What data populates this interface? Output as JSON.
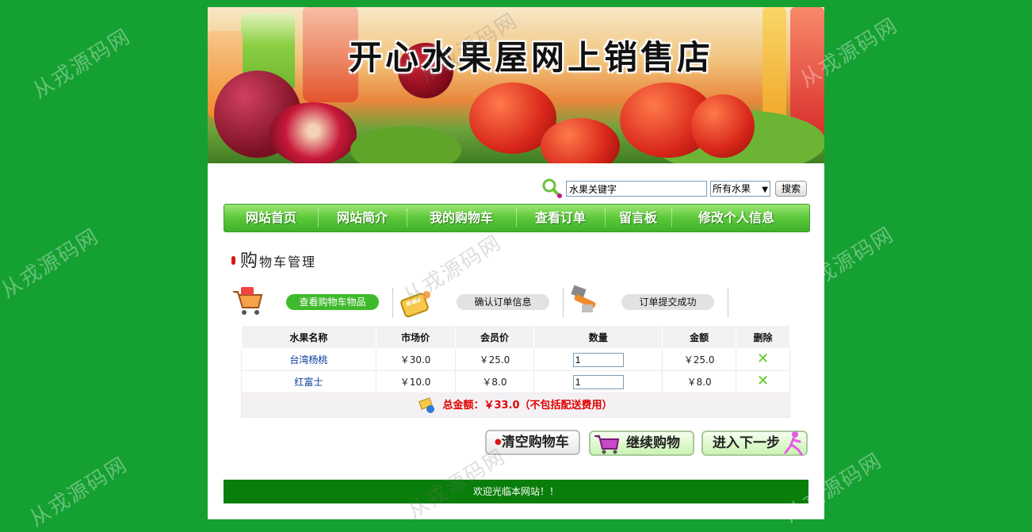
{
  "banner": {
    "title": "开心水果屋网上销售店"
  },
  "search": {
    "value": "水果关键字",
    "category": "所有水果",
    "button": "搜索"
  },
  "nav": {
    "items": [
      {
        "label": "网站首页"
      },
      {
        "label": "网站简介"
      },
      {
        "label": "我的购物车"
      },
      {
        "label": "查看订单"
      },
      {
        "label": "留言板"
      },
      {
        "label": "修改个人信息"
      }
    ]
  },
  "section": {
    "title_first": "购",
    "title_rest": "物车管理"
  },
  "steps": [
    {
      "label": "查看购物车物品",
      "active": true
    },
    {
      "label": "确认订单信息",
      "active": false
    },
    {
      "label": "订单提交成功",
      "active": false
    }
  ],
  "table": {
    "headers": [
      "水果名称",
      "市场价",
      "会员价",
      "数量",
      "金额",
      "删除"
    ],
    "rows": [
      {
        "name": "台湾杨桃",
        "market": "￥30.0",
        "member": "￥25.0",
        "qty": "1",
        "amount": "￥25.0"
      },
      {
        "name": "红富士",
        "market": "￥10.0",
        "member": "￥8.0",
        "qty": "1",
        "amount": "￥8.0"
      }
    ],
    "total": "总金额：￥33.0（不包括配送费用）"
  },
  "buttons": {
    "clear": "清空购物车",
    "continue": "继续购物",
    "next": "进入下一步"
  },
  "footer": {
    "text": "欢迎光临本网站！！"
  },
  "watermark": "从戎源码网",
  "colors": {
    "background": "#15a032",
    "nav": "#5bc83a",
    "footer": "#0a7e0a",
    "total": "#e00000",
    "link": "#0a3b9c"
  },
  "icons": [
    "search-icon",
    "cart-icon",
    "calculator-icon",
    "tools-icon",
    "money-icon",
    "delete-icon",
    "runner-icon",
    "trolley-icon"
  ]
}
